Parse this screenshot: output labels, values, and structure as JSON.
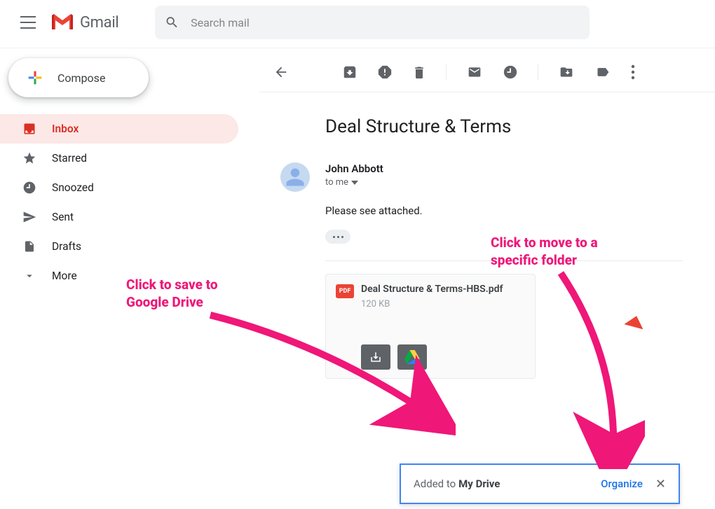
{
  "header": {
    "app_name": "Gmail",
    "search_placeholder": "Search mail"
  },
  "compose_label": "Compose",
  "sidebar": {
    "items": [
      {
        "label": "Inbox"
      },
      {
        "label": "Starred"
      },
      {
        "label": "Snoozed"
      },
      {
        "label": "Sent"
      },
      {
        "label": "Drafts"
      },
      {
        "label": "More"
      }
    ]
  },
  "message": {
    "subject": "Deal Structure & Terms",
    "sender_name": "John Abbott",
    "to_line": "to me",
    "body": "Please see attached.",
    "attachment": {
      "badge": "PDF",
      "name": "Deal Structure & Terms-HBS.pdf",
      "size": "120 KB"
    }
  },
  "toast": {
    "prefix": "Added to",
    "target": "My Drive",
    "action": "Organize",
    "close": "✕"
  },
  "annotations": {
    "left": "Click to save to\nGoogle Drive",
    "right": "Click to move to a\nspecific folder"
  }
}
